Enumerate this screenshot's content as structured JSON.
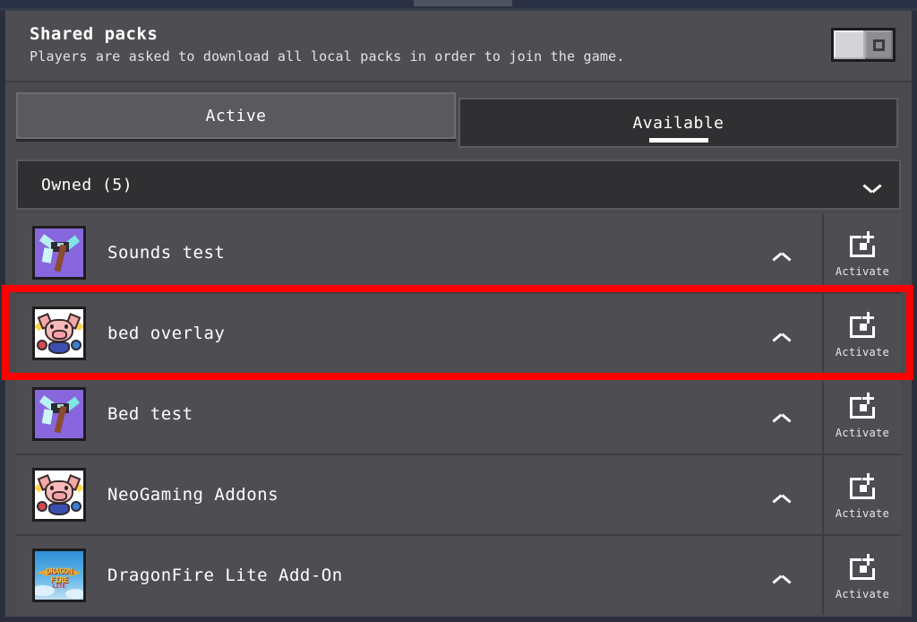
{
  "header": {
    "title": "Shared packs",
    "subtitle": "Players are asked to download all local packs in order to join the game.",
    "toggle": {
      "name": "shared-packs-toggle",
      "state": "off"
    }
  },
  "tabs": [
    {
      "id": "active",
      "label": "Active",
      "selected": false
    },
    {
      "id": "available",
      "label": "Available",
      "selected": true
    }
  ],
  "section": {
    "label": "Owned (5)",
    "count": 5,
    "expanded": true,
    "chevron": "chevron-up-icon"
  },
  "packs": [
    {
      "name": "Sounds test",
      "icon": "pickaxe-icon",
      "chevron": "chevron-down-icon",
      "action_label": "Activate",
      "action_icon": "add-to-world-icon",
      "highlighted": false
    },
    {
      "name": "bed overlay",
      "icon": "pig-icon",
      "chevron": "chevron-down-icon",
      "action_label": "Activate",
      "action_icon": "add-to-world-icon",
      "highlighted": true
    },
    {
      "name": "Bed test",
      "icon": "pickaxe-icon",
      "chevron": "chevron-down-icon",
      "action_label": "Activate",
      "action_icon": "add-to-world-icon",
      "highlighted": false
    },
    {
      "name": "NeoGaming Addons",
      "icon": "pig-icon",
      "chevron": "chevron-down-icon",
      "action_label": "Activate",
      "action_icon": "add-to-world-icon",
      "highlighted": false
    },
    {
      "name": "DragonFire Lite Add-On",
      "icon": "dragonfire-icon",
      "chevron": "chevron-down-icon",
      "action_label": "Activate",
      "action_icon": "add-to-world-icon",
      "highlighted": false
    }
  ],
  "dragon_icon_text": {
    "line1": "DRAGON",
    "line2": "FIRE",
    "line3": "LITE"
  },
  "colors": {
    "panel_bg": "#4a4a4e",
    "row_bg": "#4e4e52",
    "section_bg": "#303033",
    "tab_active_bg": "#5a5a5e",
    "tab_selected_bg": "#303033",
    "text": "#ffffff",
    "highlight_box": "#ff0000",
    "chrome": "#2b3145"
  }
}
